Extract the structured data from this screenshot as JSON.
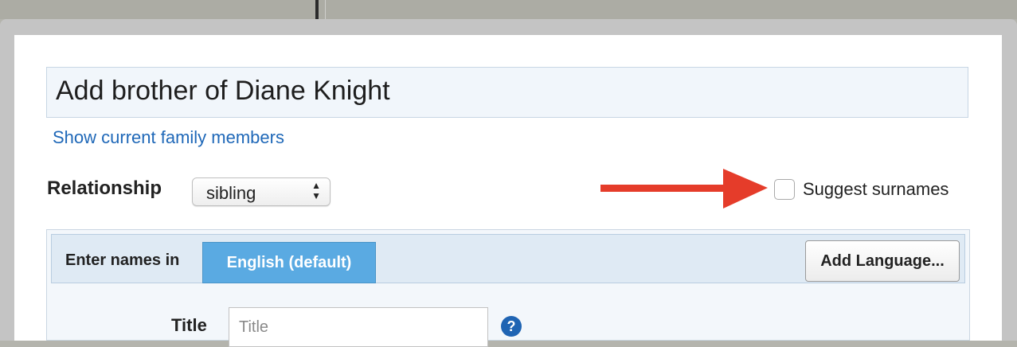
{
  "dialog": {
    "title": "Add brother of Diane Knight",
    "show_family_link": "Show current family members"
  },
  "relationship": {
    "label": "Relationship",
    "selected": "sibling",
    "arrows_icon": "▲▼"
  },
  "suggest_surnames": {
    "label": "Suggest surnames",
    "checked": false
  },
  "annotation": {
    "arrow_color": "#e53c2a"
  },
  "names": {
    "enter_label": "Enter names in",
    "active_language": "English (default)",
    "add_language_button": "Add Language..."
  },
  "title_field": {
    "label": "Title",
    "placeholder": "Title",
    "help_icon": "?"
  },
  "colors": {
    "link": "#1f68b8",
    "tab_active": "#5aaae2",
    "help_icon": "#1f64b3"
  }
}
